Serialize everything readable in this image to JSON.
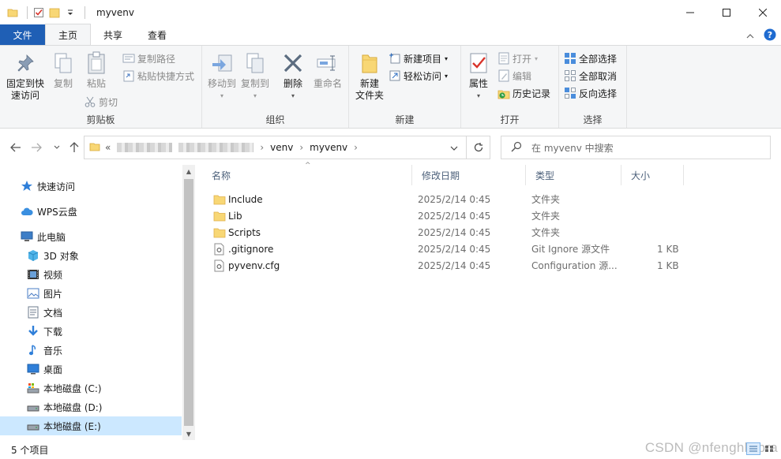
{
  "window": {
    "title": "myvenv"
  },
  "tabs": [
    "文件",
    "主页",
    "共享",
    "查看"
  ],
  "ribbon": {
    "clipboard": {
      "label": "剪贴板",
      "pin": "固定到快\n速访问",
      "copy": "复制",
      "paste": "粘贴",
      "copy_path": "复制路径",
      "paste_shortcut": "粘贴快捷方式",
      "cut": "剪切"
    },
    "organize": {
      "label": "组织",
      "move_to": "移动到",
      "copy_to": "复制到",
      "delete": "删除",
      "rename": "重命名"
    },
    "new": {
      "label": "新建",
      "new_folder": "新建\n文件夹",
      "new_item": "新建项目",
      "easy_access": "轻松访问"
    },
    "open": {
      "label": "打开",
      "properties": "属性",
      "open": "打开",
      "edit": "编辑",
      "history": "历史记录"
    },
    "select": {
      "label": "选择",
      "select_all": "全部选择",
      "select_none": "全部取消",
      "invert": "反向选择"
    }
  },
  "address": {
    "prefix": "«",
    "crumbs": [
      "venv",
      "myvenv"
    ]
  },
  "search": {
    "placeholder": "在 myvenv 中搜索"
  },
  "nav": [
    {
      "label": "快速访问",
      "icon": "star-icon"
    },
    {
      "label": "WPS云盘",
      "icon": "cloud-icon"
    },
    {
      "label": "此电脑",
      "icon": "computer-icon"
    },
    {
      "label": "3D 对象",
      "icon": "cube-icon"
    },
    {
      "label": "视频",
      "icon": "video-icon"
    },
    {
      "label": "图片",
      "icon": "picture-icon"
    },
    {
      "label": "文档",
      "icon": "document-icon"
    },
    {
      "label": "下载",
      "icon": "download-icon"
    },
    {
      "label": "音乐",
      "icon": "music-icon"
    },
    {
      "label": "桌面",
      "icon": "desktop-icon"
    },
    {
      "label": "本地磁盘 (C:)",
      "icon": "drive-c-icon"
    },
    {
      "label": "本地磁盘 (D:)",
      "icon": "drive-icon"
    },
    {
      "label": "本地磁盘 (E:)",
      "icon": "drive-icon"
    }
  ],
  "columns": {
    "name": "名称",
    "modified": "修改日期",
    "type": "类型",
    "size": "大小"
  },
  "files": [
    {
      "name": "Include",
      "modified": "2025/2/14 0:45",
      "type": "文件夹",
      "size": "",
      "kind": "folder"
    },
    {
      "name": "Lib",
      "modified": "2025/2/14 0:45",
      "type": "文件夹",
      "size": "",
      "kind": "folder"
    },
    {
      "name": "Scripts",
      "modified": "2025/2/14 0:45",
      "type": "文件夹",
      "size": "",
      "kind": "folder"
    },
    {
      "name": ".gitignore",
      "modified": "2025/2/14 0:45",
      "type": "Git Ignore 源文件",
      "size": "1 KB",
      "kind": "file"
    },
    {
      "name": "pyvenv.cfg",
      "modified": "2025/2/14 0:45",
      "type": "Configuration 源...",
      "size": "1 KB",
      "kind": "file"
    }
  ],
  "status": {
    "count": "5 个项目"
  },
  "watermark": "CSDN @nfenghklibra",
  "colors": {
    "file_tab": "#1f5fb5",
    "folder": "#f8d775",
    "selected": "#cce8ff"
  }
}
